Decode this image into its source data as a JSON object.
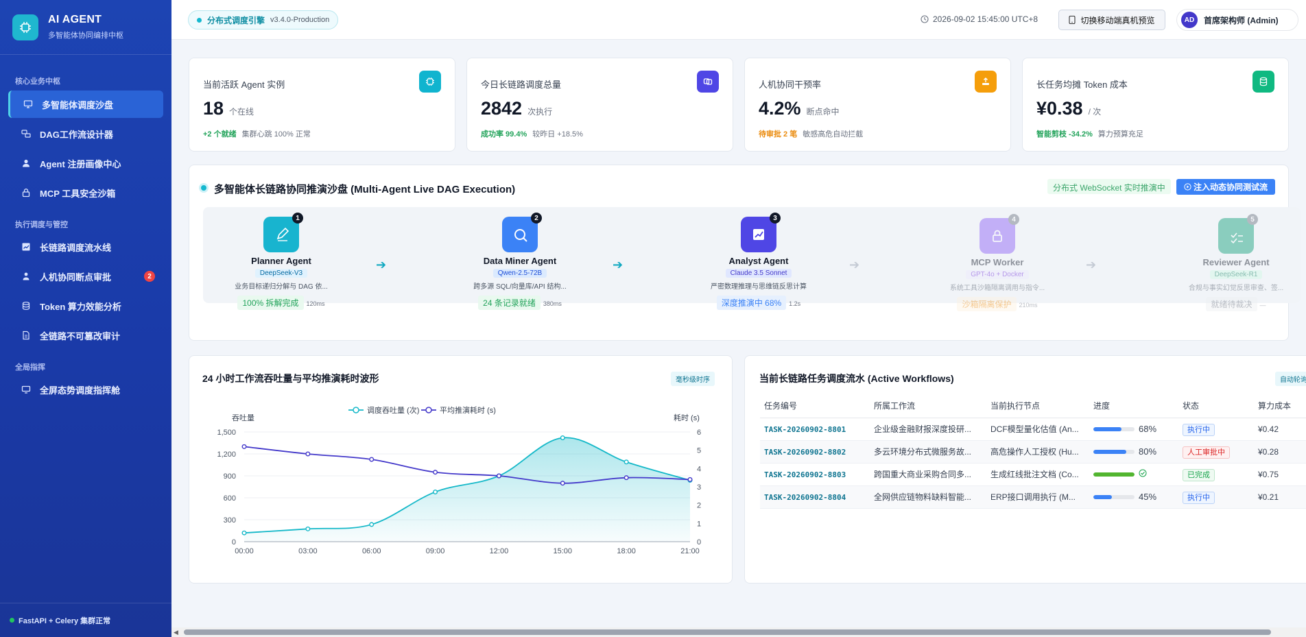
{
  "brand": {
    "title": "AI AGENT",
    "subtitle": "多智能体协同编排中枢"
  },
  "sidebar": {
    "groups": [
      "核心业务中枢",
      "执行调度与管控",
      "全局指挥"
    ],
    "items": [
      {
        "label": "多智能体调度沙盘",
        "icon": "monitor-icon"
      },
      {
        "label": "DAG工作流设计器",
        "icon": "flow-icon"
      },
      {
        "label": "Agent 注册画像中心",
        "icon": "user-icon"
      },
      {
        "label": "MCP 工具安全沙箱",
        "icon": "lock-icon"
      },
      {
        "label": "长链路调度流水线",
        "icon": "chart-icon"
      },
      {
        "label": "人机协同断点审批",
        "icon": "approval-icon",
        "badge": "2"
      },
      {
        "label": "Token 算力效能分析",
        "icon": "database-icon"
      },
      {
        "label": "全链路不可篡改审计",
        "icon": "document-icon"
      },
      {
        "label": "全屏态势调度指挥舱",
        "icon": "screen-icon"
      }
    ],
    "footer": "FastAPI + Celery 集群正常"
  },
  "topbar": {
    "env_label": "分布式调度引擎",
    "env_version": "v3.4.0-Production",
    "datetime": "2026-09-02 15:45:00 UTC+8",
    "mobile_preview": "切换移动端真机预览",
    "user_initials": "AD",
    "user_name": "首席架构师 (Admin)"
  },
  "kpis": [
    {
      "title": "当前活跃 Agent 实例",
      "value": "18",
      "unit": "个在线",
      "foot_hl": "+2 个就绪",
      "foot_text": "集群心跳 100% 正常",
      "color": "#10b4cf",
      "hl_color": "#22a35a"
    },
    {
      "title": "今日长链路调度总量",
      "value": "2842",
      "unit": "次执行",
      "foot_hl": "成功率 99.4%",
      "foot_text": "较昨日 +18.5%",
      "color": "#4f46e5",
      "hl_color": "#22a35a"
    },
    {
      "title": "人机协同干预率",
      "value": "4.2%",
      "unit": "断点命中",
      "foot_hl": "待审批 2 笔",
      "foot_text": "敏感高危自动拦截",
      "color": "#f59e0b",
      "hl_color": "#ea8a0c"
    },
    {
      "title": "长任务均摊 Token 成本",
      "value": "¥0.38",
      "unit": "/ 次",
      "foot_hl": "智能剪枝 -34.2%",
      "foot_text": "算力预算充足",
      "color": "#10b981",
      "hl_color": "#22a35a"
    }
  ],
  "dag": {
    "title": "多智能体长链路协同推演沙盘 (Multi-Agent Live DAG Execution)",
    "ws_label": "分布式 WebSocket 实时推演中",
    "inject_button": "注入动态协同测试流",
    "steps": [
      {
        "num": "1",
        "name": "Planner Agent",
        "model": "DeepSeek-V3",
        "desc": "业务目标递归分解与 DAG 依...",
        "status": "100% 拆解完成",
        "time": "120ms",
        "color": "#18b4cf",
        "status_color": "#22a35a"
      },
      {
        "num": "2",
        "name": "Data Miner Agent",
        "model": "Qwen-2.5-72B",
        "desc": "跨多源 SQL/向量库/API 结构...",
        "status": "24 条记录就绪",
        "time": "380ms",
        "color": "#3b82f6",
        "status_color": "#22a35a"
      },
      {
        "num": "3",
        "name": "Analyst Agent",
        "model": "Claude 3.5 Sonnet",
        "desc": "严密数理推理与思维链反思计算",
        "status": "深度推演中 68%",
        "time": "1.2s",
        "color": "#4f46e5",
        "status_color": "#3b82f6"
      },
      {
        "num": "4",
        "name": "MCP Worker",
        "model": "GPT-4o + Docker",
        "desc": "系统工具沙箱隔离调用与指令...",
        "status": "沙箱隔离保护",
        "time": "210ms",
        "color": "#8b5cf6",
        "status_color": "#ea8a0c"
      },
      {
        "num": "5",
        "name": "Reviewer Agent",
        "model": "DeepSeek-R1",
        "desc": "合规与事实幻觉反思审查、签...",
        "status": "就绪待裁决",
        "time": "—",
        "color": "#0f9f78",
        "status_color": "#6b7280"
      }
    ]
  },
  "chart": {
    "title": "24 小时工作流吞吐量与平均推演耗时波形",
    "badge": "毫秒级时序"
  },
  "chart_data": {
    "type": "line",
    "x": [
      "00:00",
      "03:00",
      "06:00",
      "09:00",
      "12:00",
      "15:00",
      "18:00",
      "21:00"
    ],
    "ylabel": "吞吐量",
    "y2label": "耗时 (s)",
    "ylim": [
      0,
      1500
    ],
    "y2lim": [
      0,
      6
    ],
    "yticks": [
      "0",
      "300",
      "600",
      "900",
      "1,200",
      "1,500"
    ],
    "y2ticks": [
      "0",
      "1",
      "2",
      "3",
      "4",
      "5",
      "6"
    ],
    "legend_position": "top",
    "series": [
      {
        "name": "调度吞吐量 (次)",
        "axis": "left",
        "type": "area",
        "color": "#14b8c8",
        "values": [
          120,
          175,
          235,
          680,
          900,
          1420,
          1090,
          840
        ]
      },
      {
        "name": "平均推演耗时 (s)",
        "axis": "right",
        "type": "line",
        "color": "#4338ca",
        "values": [
          5.2,
          4.8,
          4.5,
          3.8,
          3.6,
          3.2,
          3.5,
          3.4
        ]
      }
    ]
  },
  "workflows": {
    "title": "当前长链路任务调度流水 (Active Workflows)",
    "badge": "自动轮询",
    "columns": [
      "任务编号",
      "所属工作流",
      "当前执行节点",
      "进度",
      "状态",
      "算力成本"
    ],
    "rows": [
      {
        "id": "TASK-20260902-8801",
        "flow": "企业级金融财报深度投研...",
        "node": "DCF模型量化估值 (An...",
        "progress": 68,
        "progress_label": "68%",
        "status": "执行中",
        "cost": "¥0.42",
        "status_kind": "run"
      },
      {
        "id": "TASK-20260902-8802",
        "flow": "多云环境分布式微服务故...",
        "node": "高危操作人工授权 (Hu...",
        "progress": 80,
        "progress_label": "80%",
        "status": "人工审批中",
        "cost": "¥0.28",
        "status_kind": "review"
      },
      {
        "id": "TASK-20260902-8803",
        "flow": "跨国重大商业采购合同多...",
        "node": "生成红线批注文档 (Co...",
        "progress": 100,
        "progress_label": "",
        "status": "已完成",
        "cost": "¥0.75",
        "status_kind": "done"
      },
      {
        "id": "TASK-20260902-8804",
        "flow": "全网供应链物料缺料智能...",
        "node": "ERP接口调用执行 (M...",
        "progress": 45,
        "progress_label": "45%",
        "status": "执行中",
        "cost": "¥0.21",
        "status_kind": "run"
      }
    ]
  }
}
